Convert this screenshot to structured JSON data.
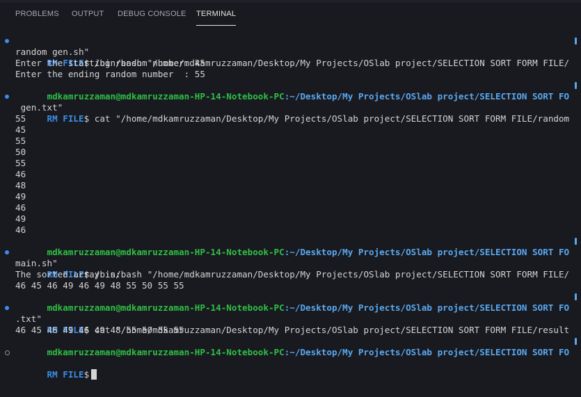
{
  "tabs": [
    {
      "label": "PROBLEMS"
    },
    {
      "label": "OUTPUT"
    },
    {
      "label": "DEBUG CONSOLE"
    },
    {
      "label": "TERMINAL",
      "active": true
    }
  ],
  "prompt_label": "RM FILE",
  "prompt_sep": "$",
  "user_host": "mdkamruzzaman@mdkamruzzaman-HP-14-Notebook-PC",
  "cwd": ":~/Desktop/My Projects/OSlab project/SELECTION SORT FO",
  "lines": {
    "l1": " /bin/bash \"/home/mdkamruzzaman/Desktop/My Projects/OSlab project/SELECTION SORT FORM FILE/",
    "l2": "random gen.sh\"",
    "l3": "Enter the starting random number: 45",
    "l4": "Enter the ending random number  : 55",
    "l6": " cat \"/home/mdkamruzzaman/Desktop/My Projects/OSlab project/SELECTION SORT FORM FILE/random",
    "l7": " gen.txt\"",
    "numbers": [
      "55",
      "45",
      "55",
      "50",
      "55",
      "46",
      "48",
      "49",
      "46",
      "49",
      "46"
    ],
    "l20": " /bin/bash \"/home/mdkamruzzaman/Desktop/My Projects/OSlab project/SELECTION SORT FORM FILE/",
    "l21": "main.sh\"",
    "l22": "The sorted array is:",
    "l23": "46 45 46 49 46 49 48 55 50 55 55",
    "l25": " cat \"/home/mdkamruzzaman/Desktop/My Projects/OSlab project/SELECTION SORT FORM FILE/result",
    "l26": ".txt\"",
    "l27": "46 45 46 49 46 49 48 55 50 55 55"
  },
  "colors": {
    "background": "#181a1f",
    "prompt_blue": "#3b8eea",
    "user_green": "#2fbf46",
    "path_blue": "#5aa8f0",
    "text": "#d4d4d4"
  }
}
